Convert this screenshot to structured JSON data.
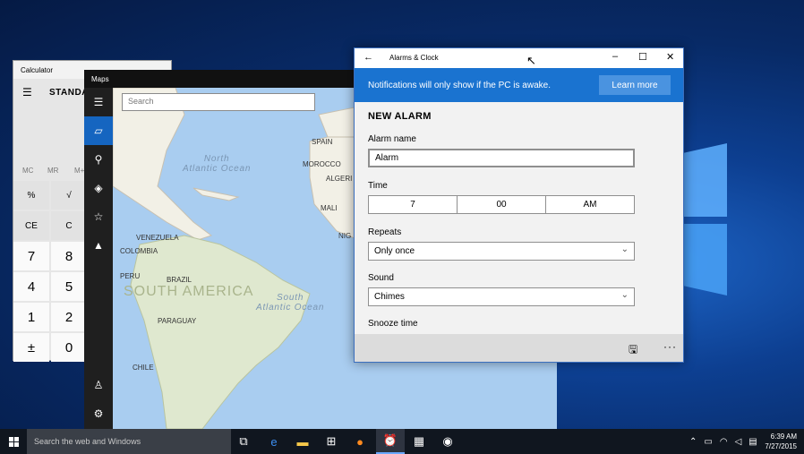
{
  "calculator": {
    "title": "Calculator",
    "mode": "STANDA",
    "memory_keys": [
      "MC",
      "MR",
      "M+"
    ],
    "keys": [
      {
        "label": "%",
        "row": 0,
        "col": 0,
        "type": "fn"
      },
      {
        "label": "√",
        "row": 0,
        "col": 1,
        "type": "fn"
      },
      {
        "label": "CE",
        "row": 1,
        "col": 0,
        "type": "fn"
      },
      {
        "label": "C",
        "row": 1,
        "col": 1,
        "type": "fn"
      },
      {
        "label": "7",
        "row": 2,
        "col": 0,
        "type": "num"
      },
      {
        "label": "8",
        "row": 2,
        "col": 1,
        "type": "num"
      },
      {
        "label": "4",
        "row": 3,
        "col": 0,
        "type": "num"
      },
      {
        "label": "5",
        "row": 3,
        "col": 1,
        "type": "num"
      },
      {
        "label": "1",
        "row": 4,
        "col": 0,
        "type": "num"
      },
      {
        "label": "2",
        "row": 4,
        "col": 1,
        "type": "num"
      },
      {
        "label": "±",
        "row": 5,
        "col": 0,
        "type": "num"
      },
      {
        "label": "0",
        "row": 5,
        "col": 1,
        "type": "num"
      }
    ]
  },
  "maps": {
    "title": "Maps",
    "search_placeholder": "Search",
    "rail_icons": [
      "menu-icon",
      "map-icon",
      "search-icon",
      "directions-icon",
      "favorites-icon",
      "3d-cities-icon",
      "account-icon",
      "settings-icon"
    ],
    "labels": {
      "spain": "SPAIN",
      "morocco": "MOROCCO",
      "algeria": "ALGERI",
      "mali": "MALI",
      "nigeria": "NIG",
      "venezuela": "VENEZUELA",
      "colombia": "COLOMBIA",
      "peru": "PERU",
      "brazil": "BRAZIL",
      "paraguay": "PARAGUAY",
      "chile": "CHILE",
      "south_america": "SOUTH AMERICA",
      "north_atlantic": [
        "North",
        "Atlantic Ocean"
      ],
      "south_atlantic": [
        "South",
        "Atlantic Ocean"
      ]
    }
  },
  "alarms": {
    "title": "Alarms & Clock",
    "notice": "Notifications will only show if the PC is awake.",
    "learn_more": "Learn more",
    "heading": "NEW ALARM",
    "alarm_name_label": "Alarm name",
    "alarm_name_value": "Alarm",
    "time_label": "Time",
    "time": {
      "hour": "7",
      "minute": "00",
      "period": "AM"
    },
    "repeats_label": "Repeats",
    "repeats_value": "Only once",
    "sound_label": "Sound",
    "sound_value": "Chimes",
    "snooze_label": "Snooze time"
  },
  "taskbar": {
    "search_placeholder": "Search the web and Windows",
    "apps": [
      "task-view-icon",
      "edge-icon",
      "file-explorer-icon",
      "store-icon",
      "firefox-icon",
      "alarms-icon",
      "calculator-icon",
      "maps-icon"
    ],
    "time": "6:39 AM",
    "date": "7/27/2015"
  },
  "colors": {
    "accent": "#1a73d0",
    "taskbar": "#10161f"
  }
}
